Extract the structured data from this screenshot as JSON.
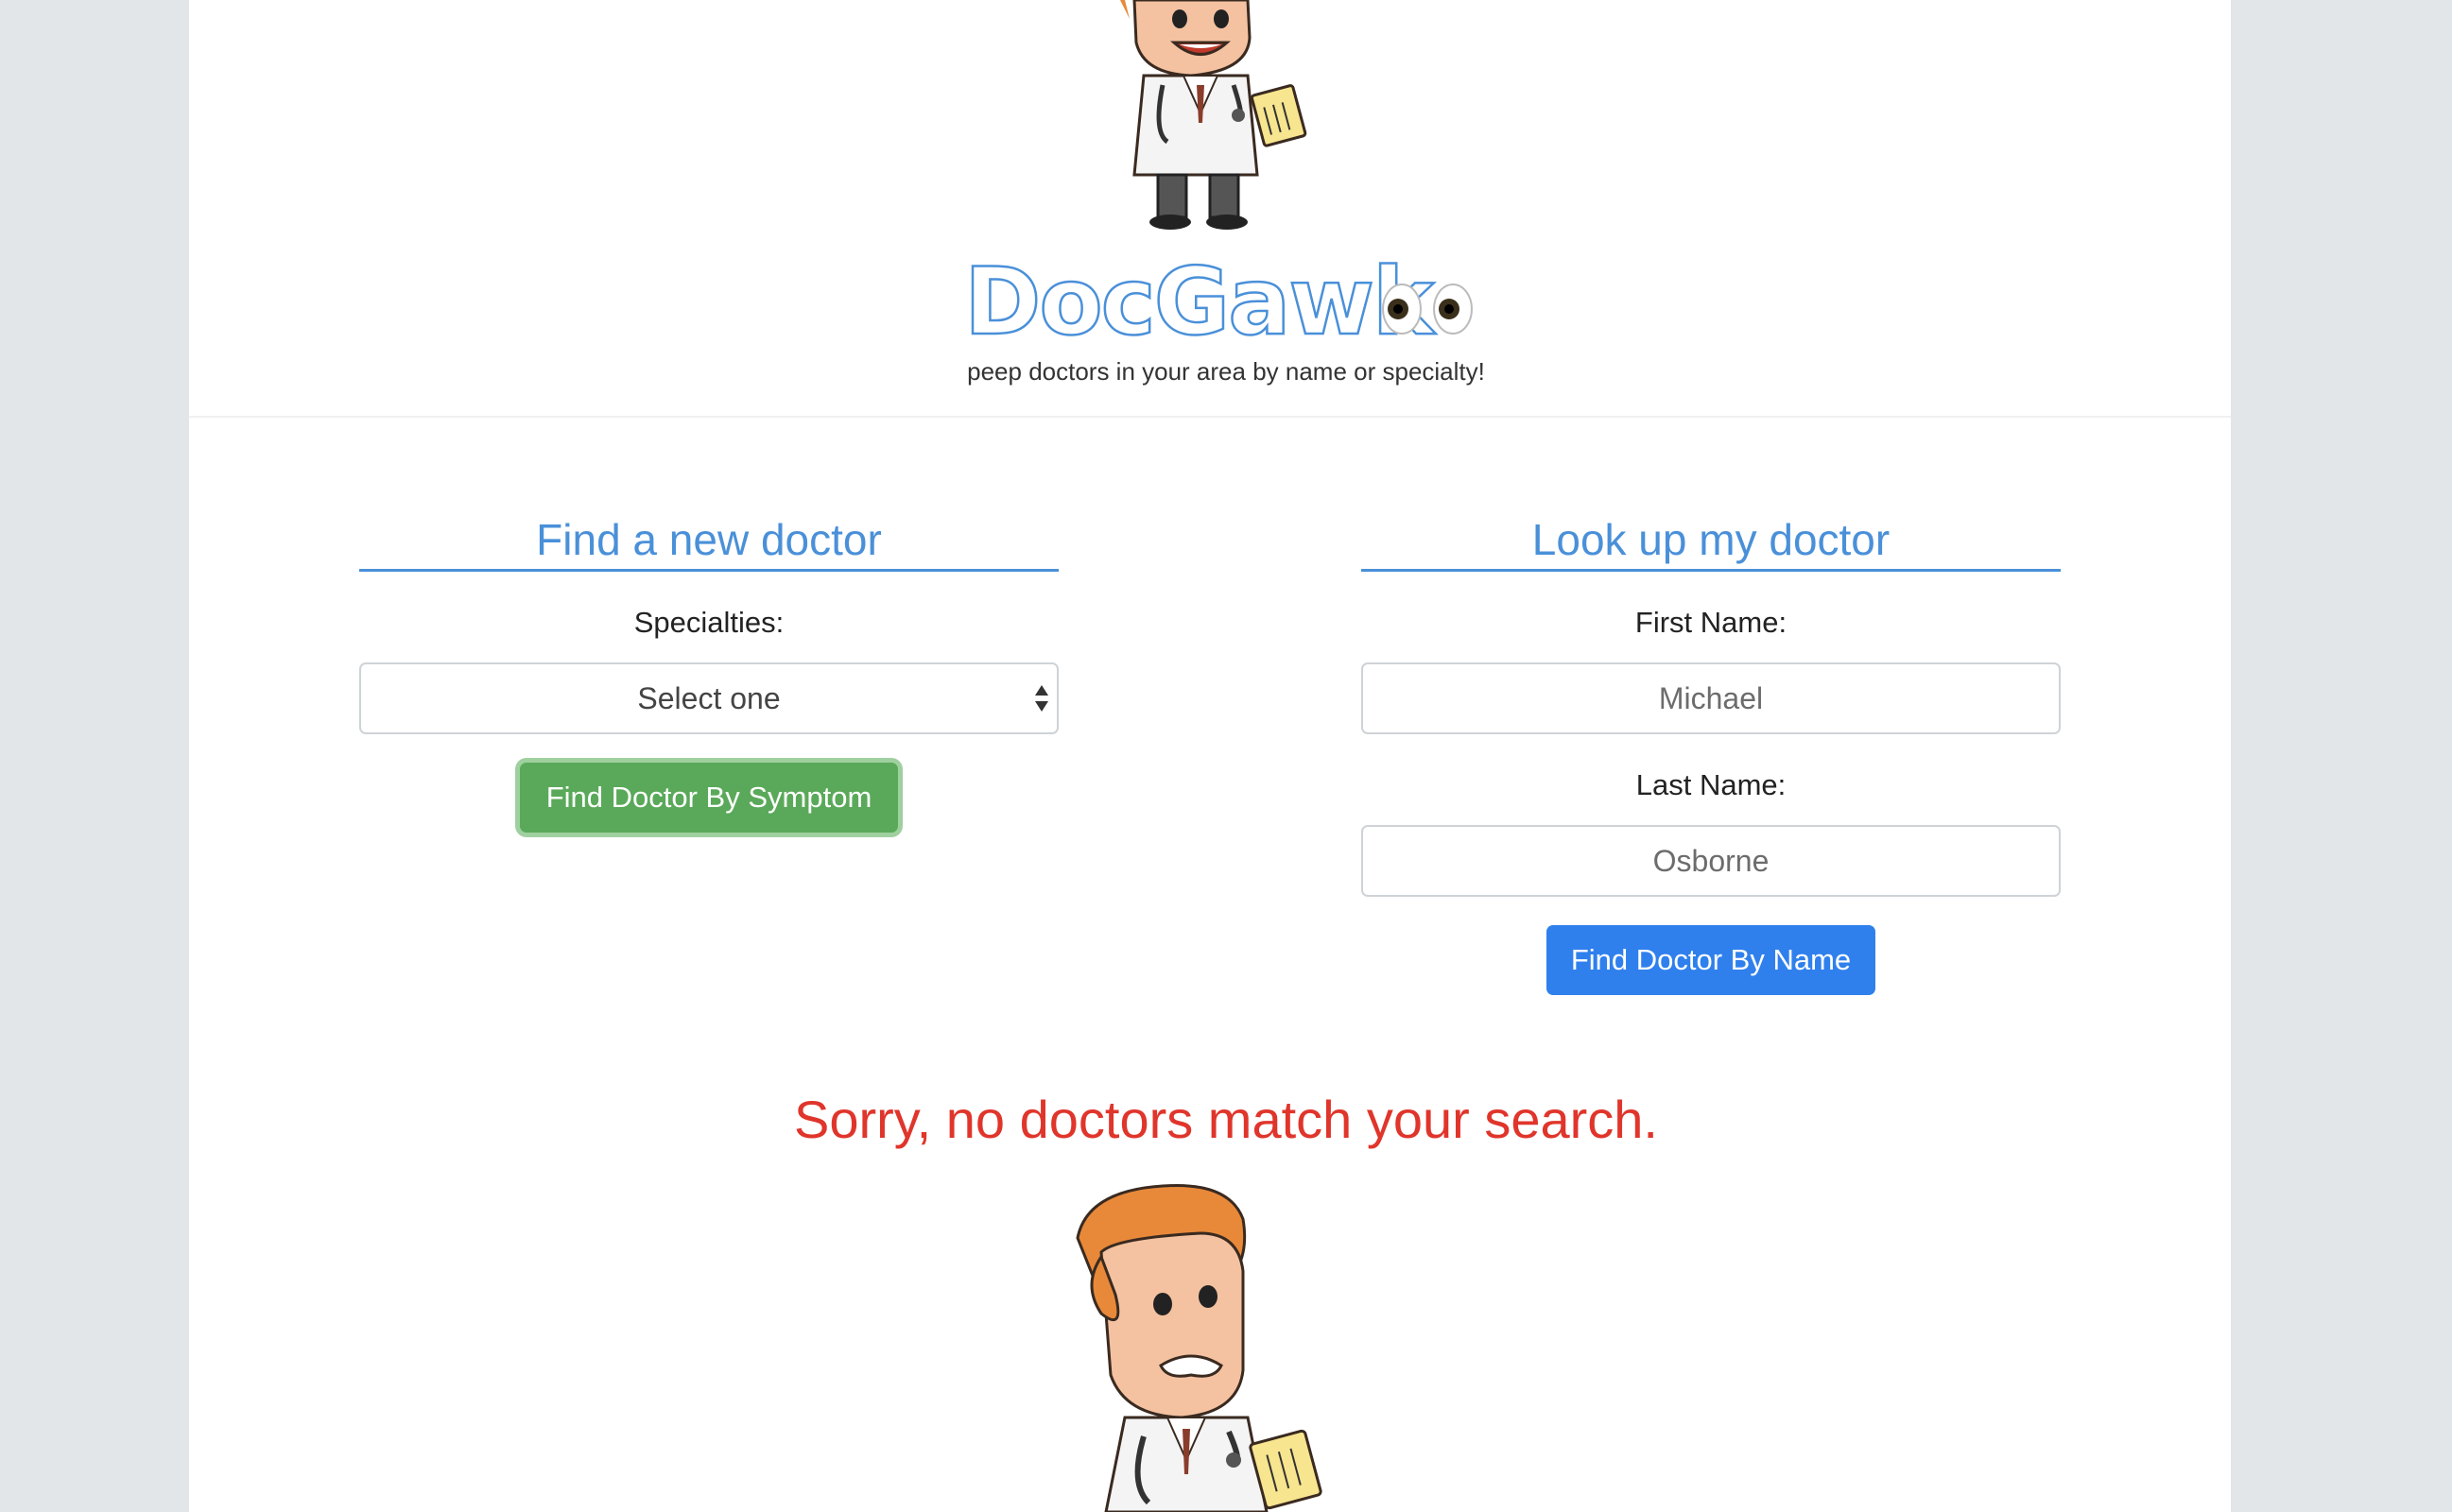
{
  "header": {
    "logo_text": "DocGawk",
    "logo_eyes": "eyes-emoji",
    "tagline": "peep doctors in your area by name or specialty!"
  },
  "specialty_search": {
    "title": "Find a new doctor",
    "label": "Specialties:",
    "select_value": "Select one",
    "button_label": "Find Doctor By Symptom"
  },
  "name_search": {
    "title": "Look up my doctor",
    "first_name_label": "First Name:",
    "first_name_placeholder": "Michael",
    "last_name_label": "Last Name:",
    "last_name_placeholder": "Osborne",
    "button_label": "Find Doctor By Name"
  },
  "results": {
    "message": "Sorry, no doctors match your search."
  },
  "colors": {
    "accent_blue": "#4a90d9",
    "button_green": "#5aa95a",
    "button_blue": "#2f80ed",
    "error_red": "#e0352b"
  }
}
